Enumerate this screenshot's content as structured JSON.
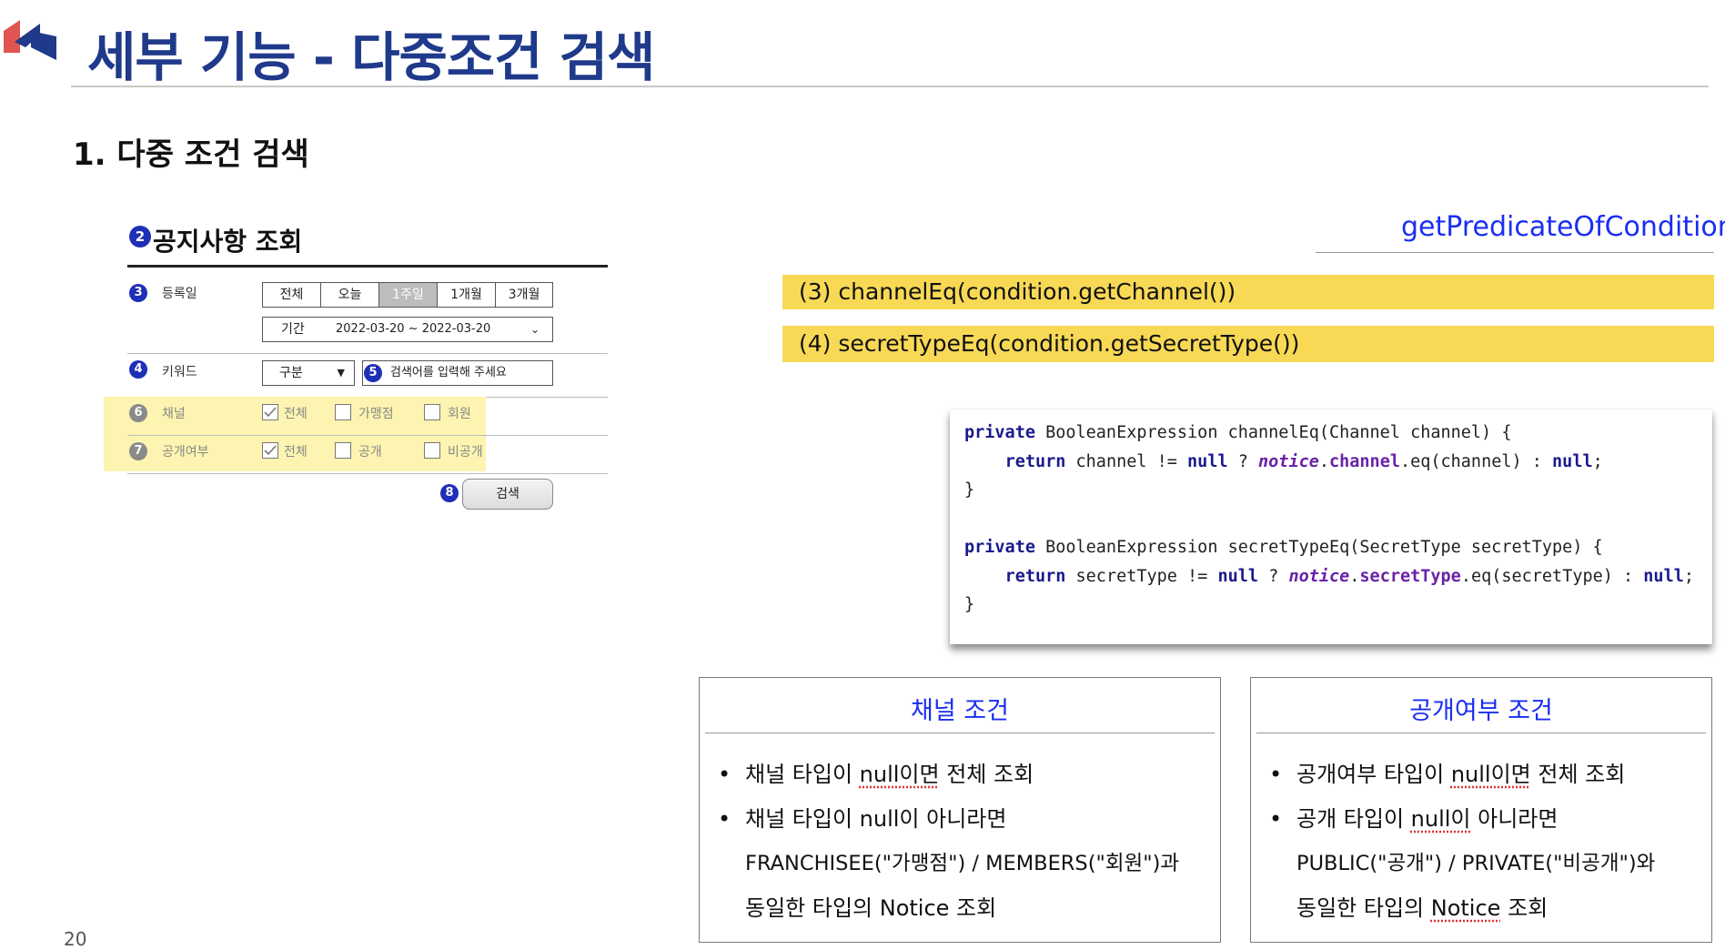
{
  "slide": {
    "title": "세부 기능 - 다중조건 검색",
    "subtitle": "1.  다중 조건 검색",
    "page_number": "20",
    "accent_color": "#1f3a8a",
    "link_color": "#1b2ef0",
    "highlight_color": "#f8d955"
  },
  "form": {
    "title_num": "2",
    "title": "공지사항 조회",
    "reg_num": "3",
    "reg_label": "등록일",
    "period_options": [
      "전체",
      "오늘",
      "1주일",
      "1개월",
      "3개월"
    ],
    "period_selected": "1주일",
    "range_label": "기간",
    "range_value": "2022-03-20 ~ 2022-03-20",
    "keyword_num": "4",
    "keyword_label": "키워드",
    "keyword_select": "구분",
    "search_num": "5",
    "search_placeholder": "검색어를 입력해 주세요",
    "channel_num": "6",
    "channel_label": "채널",
    "channel_options": [
      "전체",
      "가맹점",
      "회원"
    ],
    "public_num": "7",
    "public_label": "공개여부",
    "public_options": [
      "전체",
      "공개",
      "비공개"
    ],
    "button_num": "8",
    "search_button": "검색"
  },
  "right": {
    "method_name": "getPredicateOfCondition()",
    "highlight_1": "(3) channelEq(condition.getChannel())",
    "highlight_2": "(4) secretTypeEq(condition.getSecretType())"
  },
  "cards": {
    "channel": {
      "title": "채널 조건",
      "b1_pre": "채널 타입이 ",
      "b1_ul": "null이면",
      "b1_post": " 전체 조회",
      "b2": "채널 타입이 null이 아니라면",
      "b2_l2": "FRANCHISEE(\"가맹점\") / MEMBERS(\"회원\")과",
      "b2_l3": "동일한 타입의 Notice 조회"
    },
    "public": {
      "title": "공개여부 조건",
      "b1_pre": "공개여부 타입이 ",
      "b1_ul": "null이면",
      "b1_post": " 전체 조회",
      "b2_pre": "공개 타입이 ",
      "b2_ul": "null이",
      "b2_post": " 아니라면",
      "b2_l2": "PUBLIC(\"공개\") / PRIVATE(\"비공개\")와",
      "b2_l3_pre": "동일한 타입의 ",
      "b2_l3_ul": "Notice",
      "b2_l3_post": " 조회"
    }
  }
}
